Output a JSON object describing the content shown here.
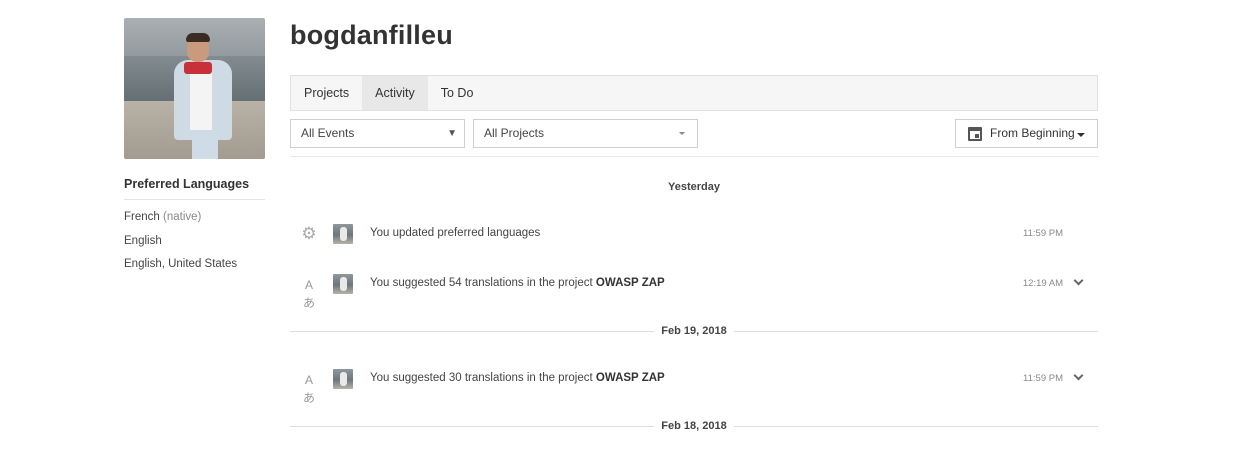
{
  "profile": {
    "username": "bogdanfilleu",
    "preferred_languages_title": "Preferred Languages",
    "languages": [
      {
        "name": "French",
        "note": "(native)"
      },
      {
        "name": "English",
        "note": ""
      },
      {
        "name": "English, United States",
        "note": ""
      }
    ]
  },
  "tabs": [
    {
      "label": "Projects",
      "active": false
    },
    {
      "label": "Activity",
      "active": true
    },
    {
      "label": "To Do",
      "active": false
    }
  ],
  "filters": {
    "events": "All Events",
    "projects": "All Projects",
    "date": "From Beginning"
  },
  "activity": {
    "groups": [
      {
        "label": "Yesterday",
        "events": [
          {
            "icon": "gear-icon",
            "text": "You updated preferred languages",
            "project": "",
            "time": "11:59 PM",
            "expandable": false
          },
          {
            "icon": "translate-icon",
            "text": "You suggested 54 translations in the project",
            "project": "OWASP ZAP",
            "time": "12:19 AM",
            "expandable": true
          }
        ]
      },
      {
        "label": "Feb 19, 2018",
        "events": [
          {
            "icon": "translate-icon",
            "text": "You suggested 30 translations in the project",
            "project": "OWASP ZAP",
            "time": "11:59 PM",
            "expandable": true
          }
        ]
      },
      {
        "label": "Feb 18, 2018",
        "events": []
      }
    ]
  },
  "icons": {
    "translate_glyph": "Aあ",
    "gear_glyph": "⚙"
  }
}
